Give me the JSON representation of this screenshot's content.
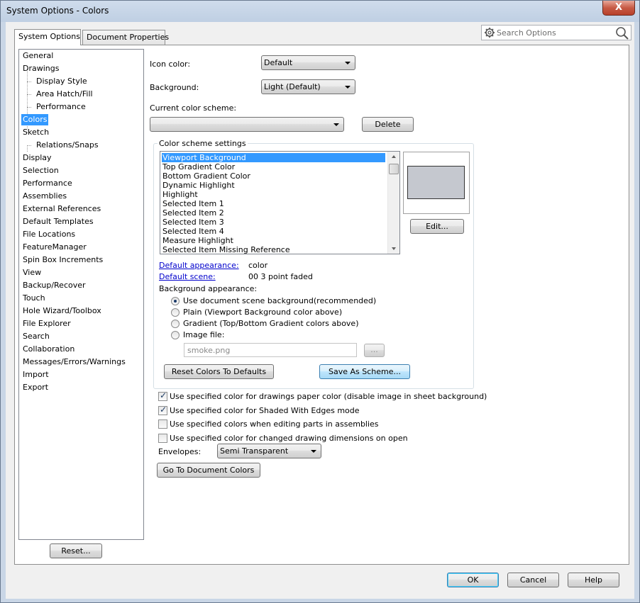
{
  "window": {
    "title": "System Options - Colors",
    "close_glyph": "X"
  },
  "tabs": [
    {
      "label": "System Options"
    },
    {
      "label": "Document Properties"
    }
  ],
  "search": {
    "placeholder": "Search Options"
  },
  "nav": {
    "items": [
      {
        "label": "General"
      },
      {
        "label": "Drawings"
      },
      {
        "label": "Display Style"
      },
      {
        "label": "Area Hatch/Fill"
      },
      {
        "label": "Performance"
      },
      {
        "label": "Colors"
      },
      {
        "label": "Sketch"
      },
      {
        "label": "Relations/Snaps"
      },
      {
        "label": "Display"
      },
      {
        "label": "Selection"
      },
      {
        "label": "Performance"
      },
      {
        "label": "Assemblies"
      },
      {
        "label": "External References"
      },
      {
        "label": "Default Templates"
      },
      {
        "label": "File Locations"
      },
      {
        "label": "FeatureManager"
      },
      {
        "label": "Spin Box Increments"
      },
      {
        "label": "View"
      },
      {
        "label": "Backup/Recover"
      },
      {
        "label": "Touch"
      },
      {
        "label": "Hole Wizard/Toolbox"
      },
      {
        "label": "File Explorer"
      },
      {
        "label": "Search"
      },
      {
        "label": "Collaboration"
      },
      {
        "label": "Messages/Errors/Warnings"
      },
      {
        "label": "Import"
      },
      {
        "label": "Export"
      }
    ],
    "reset_label": "Reset..."
  },
  "colors": {
    "icon_color_label": "Icon color:",
    "icon_color_value": "Default",
    "background_label": "Background:",
    "background_value": "Light (Default)",
    "current_scheme_label": "Current color scheme:",
    "current_scheme_value": "",
    "delete_label": "Delete",
    "scheme_group_title": "Color scheme settings",
    "scheme_items": [
      {
        "label": "Viewport Background"
      },
      {
        "label": "Top Gradient Color"
      },
      {
        "label": "Bottom Gradient Color"
      },
      {
        "label": "Dynamic Highlight"
      },
      {
        "label": "Highlight"
      },
      {
        "label": "Selected Item 1"
      },
      {
        "label": "Selected Item 2"
      },
      {
        "label": "Selected Item 3"
      },
      {
        "label": "Selected Item 4"
      },
      {
        "label": "Measure Highlight"
      },
      {
        "label": "Selected Item Missing Reference"
      }
    ],
    "preview_color": "#c5c8cf",
    "edit_label": "Edit...",
    "default_appearance_label": "Default appearance:",
    "default_appearance_value": "color",
    "default_scene_label": "Default scene:",
    "default_scene_value": "00 3 point faded",
    "bg_appearance_label": "Background appearance:",
    "bg_options": [
      {
        "label": "Use document scene background(recommended)",
        "checked": true
      },
      {
        "label": "Plain (Viewport Background color above)",
        "checked": false
      },
      {
        "label": "Gradient (Top/Bottom Gradient colors above)",
        "checked": false
      },
      {
        "label": "Image file:",
        "checked": false
      }
    ],
    "image_file_value": "smoke.png",
    "browse_label": "...",
    "reset_colors_label": "Reset Colors To Defaults",
    "save_scheme_label": "Save As Scheme...",
    "checkboxes": [
      {
        "label": "Use specified color for drawings paper color (disable image in sheet background)",
        "checked": true
      },
      {
        "label": "Use specified color for Shaded With Edges mode",
        "checked": true
      },
      {
        "label": "Use specified colors when editing parts in assemblies",
        "checked": false
      },
      {
        "label": "Use specified color for changed drawing dimensions on open",
        "checked": false
      }
    ],
    "envelopes_label": "Envelopes:",
    "envelopes_value": "Semi Transparent",
    "go_to_doc_colors_label": "Go To Document Colors"
  },
  "footer": {
    "ok_label": "OK",
    "cancel_label": "Cancel",
    "help_label": "Help"
  }
}
